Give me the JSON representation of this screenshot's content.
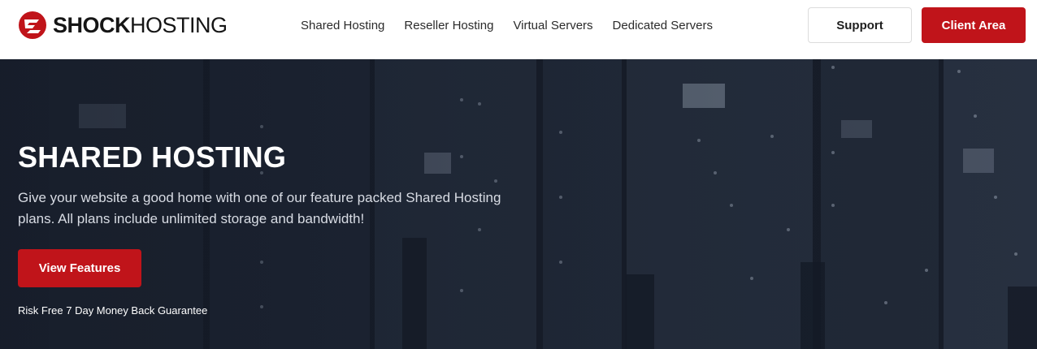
{
  "brand": {
    "name_bold": "SHOCK",
    "name_light": "HOSTING",
    "accent_color": "#c0141a"
  },
  "nav": {
    "items": [
      {
        "label": "Shared Hosting"
      },
      {
        "label": "Reseller Hosting"
      },
      {
        "label": "Virtual Servers"
      },
      {
        "label": "Dedicated Servers"
      }
    ]
  },
  "header_buttons": {
    "support_label": "Support",
    "client_area_label": "Client Area"
  },
  "hero": {
    "title": "SHARED HOSTING",
    "description": "Give your website a good home with one of our feature packed Shared Hosting plans. All plans include unlimited storage and bandwidth!",
    "cta_label": "View Features",
    "guarantee": "Risk Free 7 Day Money Back Guarantee",
    "background_image": "server-racks"
  }
}
